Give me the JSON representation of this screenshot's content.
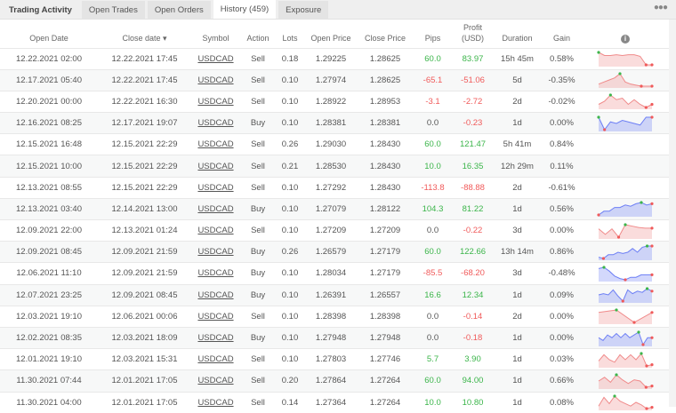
{
  "tabs": [
    "Trading Activity",
    "Open Trades",
    "Open Orders",
    "History (459)",
    "Exposure"
  ],
  "more_icon": "more-dots-icon",
  "headers": {
    "open_date": "Open Date",
    "close_date": "Close date ▾",
    "symbol": "Symbol",
    "action": "Action",
    "lots": "Lots",
    "open_price": "Open Price",
    "close_price": "Close Price",
    "pips": "Pips",
    "profit1": "Profit",
    "profit2": "(USD)",
    "duration": "Duration",
    "gain": "Gain"
  },
  "colors": {
    "pos": "#3bb54a",
    "neg": "#f05a5a",
    "blue": "#6d7ff5",
    "red": "#f08a8a"
  },
  "rows": [
    {
      "open": "12.22.2021 02:00",
      "close": "12.22.2021 17:45",
      "symbol": "USDCAD",
      "action": "Sell",
      "lots": "0.18",
      "op": "1.29225",
      "cp": "1.28625",
      "pips": "60.0",
      "profit": "83.97",
      "dur": "15h 45m",
      "gain": "0.58%",
      "spark": "red",
      "pts": [
        9,
        7,
        7,
        7.5,
        7,
        7.5,
        7.5,
        6.5,
        1,
        1
      ]
    },
    {
      "open": "12.17.2021 05:40",
      "close": "12.22.2021 17:45",
      "symbol": "USDCAD",
      "action": "Sell",
      "lots": "0.10",
      "op": "1.27974",
      "cp": "1.28625",
      "pips": "-65.1",
      "profit": "-51.06",
      "dur": "5d",
      "gain": "-0.35%",
      "spark": "red",
      "pts": [
        5,
        6,
        7,
        8,
        10,
        6,
        5,
        4.5,
        4,
        4,
        4
      ]
    },
    {
      "open": "12.20.2021 00:00",
      "close": "12.22.2021 16:30",
      "symbol": "USDCAD",
      "action": "Sell",
      "lots": "0.10",
      "op": "1.28922",
      "cp": "1.28953",
      "pips": "-3.1",
      "profit": "-2.72",
      "dur": "2d",
      "gain": "-0.02%",
      "spark": "red",
      "pts": [
        3,
        5,
        9,
        6,
        7,
        3,
        6,
        3,
        1,
        3
      ]
    },
    {
      "open": "12.16.2021 08:25",
      "close": "12.17.2021 19:07",
      "symbol": "USDCAD",
      "action": "Buy",
      "lots": "0.10",
      "op": "1.28381",
      "cp": "1.28381",
      "pips": "0.0",
      "profit": "-0.23",
      "dur": "1d",
      "gain": "0.00%",
      "spark": "blue",
      "pts": [
        9,
        1,
        6,
        5,
        7,
        6,
        5,
        4,
        9,
        9
      ]
    },
    {
      "open": "12.15.2021 16:48",
      "close": "12.15.2021 22:29",
      "symbol": "USDCAD",
      "action": "Sell",
      "lots": "0.26",
      "op": "1.29030",
      "cp": "1.28430",
      "pips": "60.0",
      "profit": "121.47",
      "dur": "5h 41m",
      "gain": "0.84%",
      "spark": "",
      "pts": []
    },
    {
      "open": "12.15.2021 10:00",
      "close": "12.15.2021 22:29",
      "symbol": "USDCAD",
      "action": "Sell",
      "lots": "0.21",
      "op": "1.28530",
      "cp": "1.28430",
      "pips": "10.0",
      "profit": "16.35",
      "dur": "12h 29m",
      "gain": "0.11%",
      "spark": "",
      "pts": []
    },
    {
      "open": "12.13.2021 08:55",
      "close": "12.15.2021 22:29",
      "symbol": "USDCAD",
      "action": "Sell",
      "lots": "0.10",
      "op": "1.27292",
      "cp": "1.28430",
      "pips": "-113.8",
      "profit": "-88.88",
      "dur": "2d",
      "gain": "-0.61%",
      "spark": "",
      "pts": []
    },
    {
      "open": "12.13.2021 03:40",
      "close": "12.14.2021 13:00",
      "symbol": "USDCAD",
      "action": "Buy",
      "lots": "0.10",
      "op": "1.27079",
      "cp": "1.28122",
      "pips": "104.3",
      "profit": "81.22",
      "dur": "1d",
      "gain": "0.56%",
      "spark": "blue",
      "pts": [
        0,
        3,
        3,
        6,
        6,
        8,
        7,
        9,
        10,
        8,
        9
      ]
    },
    {
      "open": "12.09.2021 22:00",
      "close": "12.13.2021 01:24",
      "symbol": "USDCAD",
      "action": "Sell",
      "lots": "0.10",
      "op": "1.27209",
      "cp": "1.27209",
      "pips": "0.0",
      "profit": "-0.22",
      "dur": "3d",
      "gain": "0.00%",
      "spark": "red",
      "pts": [
        6,
        2,
        6,
        0,
        9,
        8,
        7,
        6.5,
        6.5
      ]
    },
    {
      "open": "12.09.2021 08:45",
      "close": "12.09.2021 21:59",
      "symbol": "USDCAD",
      "action": "Buy",
      "lots": "0.26",
      "op": "1.26579",
      "cp": "1.27179",
      "pips": "60.0",
      "profit": "122.66",
      "dur": "13h 14m",
      "gain": "0.86%",
      "spark": "blue",
      "pts": [
        1,
        0,
        3,
        3,
        5,
        4,
        5,
        8,
        5,
        9,
        10,
        10
      ]
    },
    {
      "open": "12.06.2021 11:10",
      "close": "12.09.2021 21:59",
      "symbol": "USDCAD",
      "action": "Buy",
      "lots": "0.10",
      "op": "1.28034",
      "cp": "1.27179",
      "pips": "-85.5",
      "profit": "-68.20",
      "dur": "3d",
      "gain": "-0.48%",
      "spark": "blue",
      "pts": [
        9,
        10,
        7,
        3,
        1,
        0,
        2,
        2,
        4,
        4,
        4
      ]
    },
    {
      "open": "12.07.2021 23:25",
      "close": "12.09.2021 08:45",
      "symbol": "USDCAD",
      "action": "Buy",
      "lots": "0.10",
      "op": "1.26391",
      "cp": "1.26557",
      "pips": "16.6",
      "profit": "12.34",
      "dur": "1d",
      "gain": "0.09%",
      "spark": "blue",
      "pts": [
        5,
        6,
        5,
        9,
        4,
        0,
        9,
        6,
        8,
        7,
        10,
        8
      ]
    },
    {
      "open": "12.03.2021 19:10",
      "close": "12.06.2021 00:06",
      "symbol": "USDCAD",
      "action": "Sell",
      "lots": "0.10",
      "op": "1.28398",
      "cp": "1.28398",
      "pips": "0.0",
      "profit": "-0.14",
      "dur": "2d",
      "gain": "0.00%",
      "spark": "red",
      "pts": [
        8,
        10,
        0,
        8
      ]
    },
    {
      "open": "12.02.2021 08:35",
      "close": "12.03.2021 18:09",
      "symbol": "USDCAD",
      "action": "Buy",
      "lots": "0.10",
      "op": "1.27948",
      "cp": "1.27948",
      "pips": "0.0",
      "profit": "-0.18",
      "dur": "1d",
      "gain": "0.00%",
      "spark": "blue",
      "pts": [
        5,
        3,
        7,
        5,
        8,
        5,
        8,
        5,
        7,
        9,
        0,
        5,
        5
      ]
    },
    {
      "open": "12.01.2021 19:10",
      "close": "12.03.2021 15:31",
      "symbol": "USDCAD",
      "action": "Sell",
      "lots": "0.10",
      "op": "1.27803",
      "cp": "1.27746",
      "pips": "5.7",
      "profit": "3.90",
      "dur": "1d",
      "gain": "0.03%",
      "spark": "red",
      "pts": [
        4,
        9,
        5,
        3,
        9,
        5,
        9,
        5,
        10,
        0,
        1
      ]
    },
    {
      "open": "11.30.2021 07:44",
      "close": "12.01.2021 17:05",
      "symbol": "USDCAD",
      "action": "Sell",
      "lots": "0.20",
      "op": "1.27864",
      "cp": "1.27264",
      "pips": "60.0",
      "profit": "94.00",
      "dur": "1d",
      "gain": "0.66%",
      "spark": "red",
      "pts": [
        5,
        8,
        4,
        10,
        6,
        3,
        6,
        5,
        0,
        1
      ]
    },
    {
      "open": "11.30.2021 04:00",
      "close": "12.01.2021 17:05",
      "symbol": "USDCAD",
      "action": "Sell",
      "lots": "0.14",
      "op": "1.27364",
      "cp": "1.27264",
      "pips": "10.0",
      "profit": "10.80",
      "dur": "1d",
      "gain": "0.08%",
      "spark": "red",
      "pts": [
        2,
        9,
        4,
        10,
        6,
        4,
        2,
        5,
        3,
        0,
        1
      ]
    }
  ]
}
